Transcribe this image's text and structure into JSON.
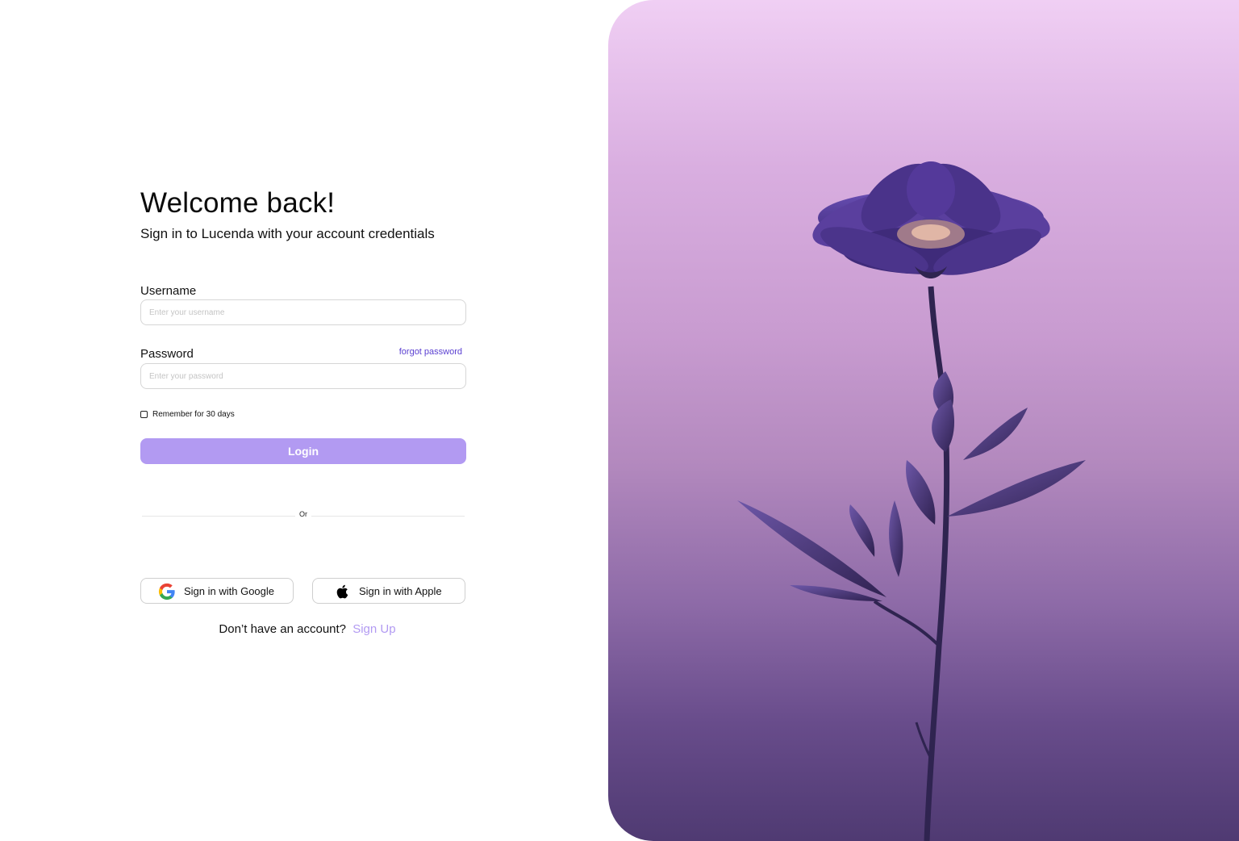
{
  "login": {
    "title": "Welcome back!",
    "subtitle": "Sign in to Lucenda with your account credentials",
    "username_label": "Username",
    "username_placeholder": "Enter your username",
    "password_label": "Password",
    "password_placeholder": "Enter your password",
    "forgot_password": "forgot password",
    "remember_label": "Remember for 30 days",
    "remember_checked": false,
    "login_button": "Login",
    "divider_text": "Or",
    "google_button": "Sign in with Google",
    "apple_button": "Sign in with Apple",
    "signup_prompt": "Don’t have an account?",
    "signup_link": "Sign Up"
  },
  "icons": {
    "google": "google-icon",
    "apple": "apple-icon"
  },
  "colors": {
    "accent": "#b29af2",
    "forgot_link": "#5a3fd1",
    "hero_top": "#f0cff4",
    "hero_bottom": "#4f3a72",
    "flower": "#5a3f9e"
  }
}
